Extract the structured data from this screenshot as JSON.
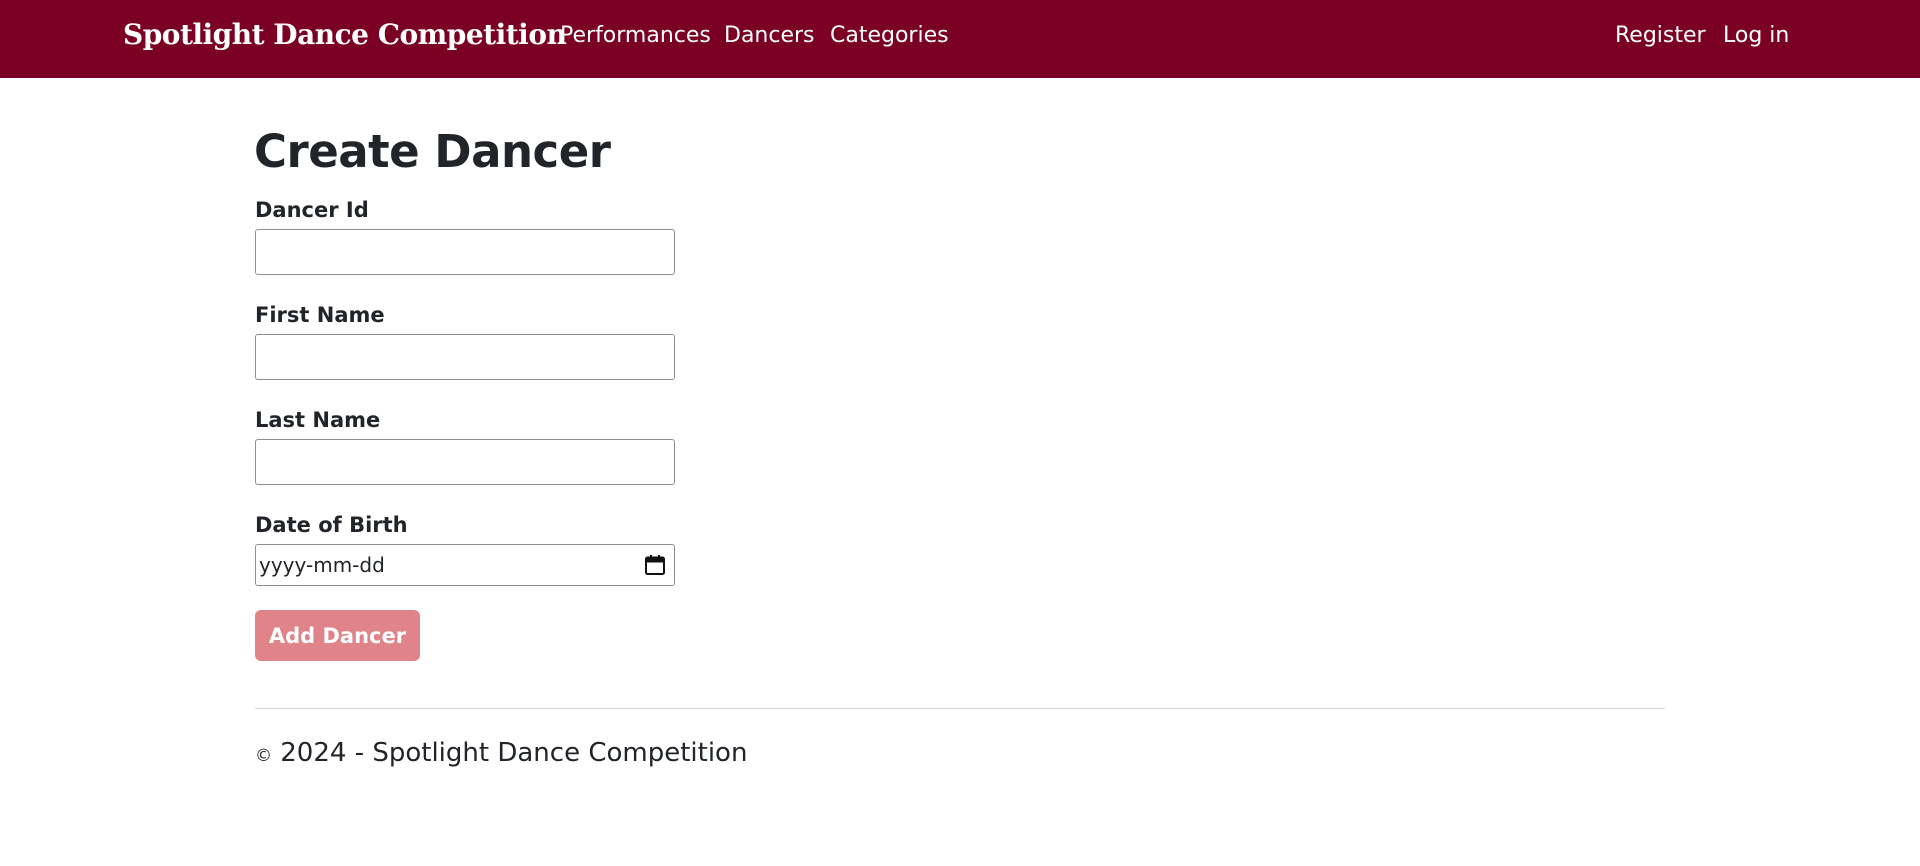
{
  "navbar": {
    "brand": "Spotlight Dance Competition",
    "links": [
      {
        "label": "Performances"
      },
      {
        "label": "Dancers"
      },
      {
        "label": "Categories"
      }
    ],
    "register_label": "Register",
    "login_label": "Log in",
    "background_color": "#7a0024"
  },
  "main": {
    "title": "Create Dancer",
    "fields": [
      {
        "label": "Dancer Id",
        "value": ""
      },
      {
        "label": "First Name",
        "value": ""
      },
      {
        "label": "Last Name",
        "value": ""
      },
      {
        "label": "Date of Birth",
        "placeholder": "yyyy-mm-dd",
        "icon": "calendar-icon"
      }
    ],
    "submit_label": "Add Dancer",
    "submit_color": "#e08489"
  },
  "footer": {
    "copyright_symbol": "©",
    "text": "2024 - Spotlight Dance Competition"
  }
}
